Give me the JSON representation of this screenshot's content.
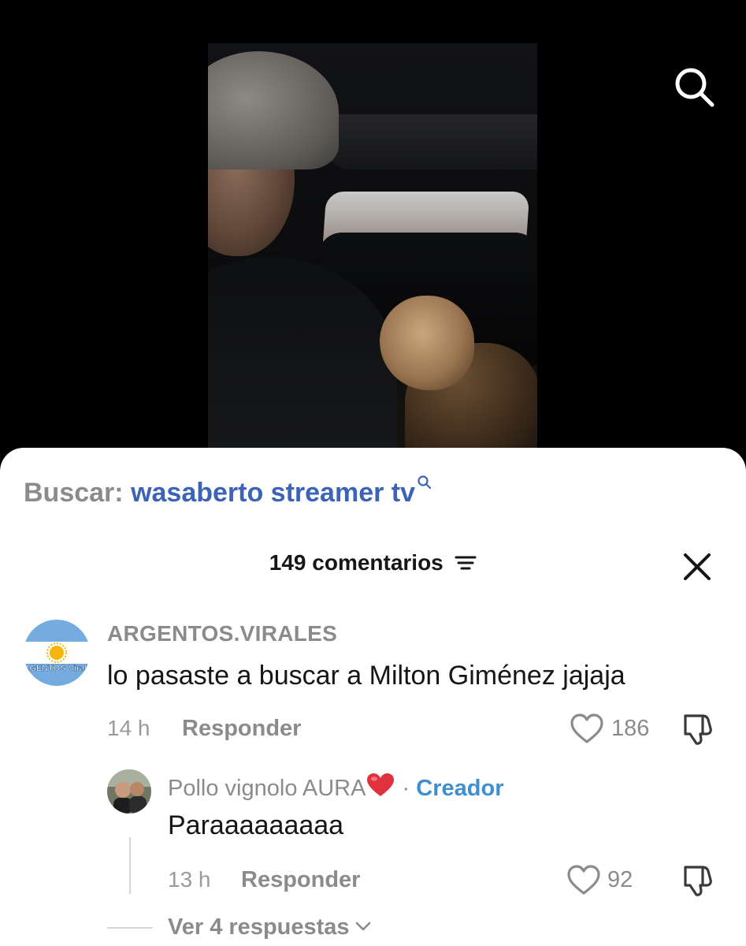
{
  "search_suggestion": {
    "prefix": "Buscar:",
    "query": "wasaberto streamer tv"
  },
  "comments_panel": {
    "count_label": "149 comentarios"
  },
  "comments": [
    {
      "username": "ARGENTOS.VIRALES",
      "avatar_text": "ARGENTOS Virales",
      "text": "lo pasaste a buscar a Milton Giménez jajaja",
      "time": "14 h",
      "reply_label": "Responder",
      "likes": "186"
    }
  ],
  "reply": {
    "username": "Pollo vignolo AURA",
    "separator": "·",
    "badge": "Creador",
    "text": "Paraaaaaaaaa",
    "time": "13 h",
    "reply_label": "Responder",
    "likes": "92"
  },
  "view_replies_label": "Ver 4 respuestas",
  "colors": {
    "link_blue": "#3c63b8",
    "creator_blue": "#3d8fd0",
    "muted_gray": "#8b8b8b",
    "heart_red": "#e0323c"
  },
  "icons": [
    "search-icon",
    "sort-icon",
    "close-icon",
    "heart-icon",
    "dislike-icon",
    "chevron-down-icon"
  ]
}
